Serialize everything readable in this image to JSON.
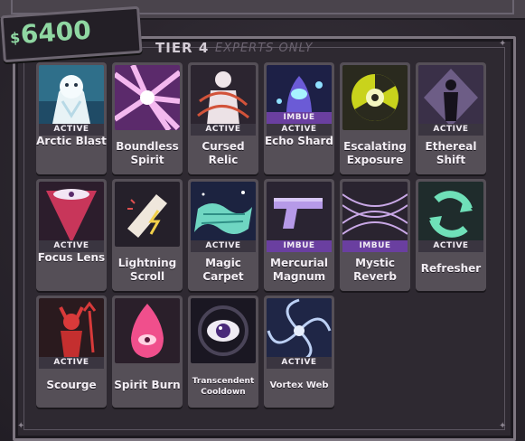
{
  "money": {
    "symbol": "$",
    "amount": "6400"
  },
  "tier": {
    "label": "TIER 4",
    "subtitle": "EXPERTS ONLY"
  },
  "cards": [
    {
      "name": "Arctic Blast",
      "active": "ACTIVE",
      "imbue": "",
      "icon": "polar-bear-icon"
    },
    {
      "name": "Boundless Spirit",
      "active": "",
      "imbue": "",
      "icon": "spirit-burst-icon"
    },
    {
      "name": "Cursed Relic",
      "active": "ACTIVE",
      "imbue": "",
      "icon": "cursed-figure-icon"
    },
    {
      "name": "Echo Shard",
      "active": "ACTIVE",
      "imbue": "IMBUE",
      "icon": "shard-creature-icon"
    },
    {
      "name": "Escalating Exposure",
      "active": "",
      "imbue": "",
      "icon": "radiation-eye-icon"
    },
    {
      "name": "Ethereal Shift",
      "active": "ACTIVE",
      "imbue": "",
      "icon": "ethereal-figure-icon"
    },
    {
      "name": "Focus Lens",
      "active": "ACTIVE",
      "imbue": "",
      "icon": "focus-lens-icon"
    },
    {
      "name": "Lightning Scroll",
      "active": "",
      "imbue": "",
      "icon": "scroll-icon"
    },
    {
      "name": "Magic Carpet",
      "active": "ACTIVE",
      "imbue": "",
      "icon": "carpet-icon"
    },
    {
      "name": "Mercurial Magnum",
      "active": "",
      "imbue": "IMBUE",
      "icon": "pistol-icon"
    },
    {
      "name": "Mystic Reverb",
      "active": "",
      "imbue": "IMBUE",
      "icon": "reverb-waves-icon"
    },
    {
      "name": "Refresher",
      "active": "ACTIVE",
      "imbue": "",
      "icon": "refresh-arrows-icon"
    },
    {
      "name": "Scourge",
      "active": "ACTIVE",
      "imbue": "",
      "icon": "devil-icon"
    },
    {
      "name": "Spirit Burn",
      "active": "",
      "imbue": "",
      "icon": "flame-eye-icon"
    },
    {
      "name": "Transcendent Cooldown",
      "active": "",
      "imbue": "",
      "icon": "cosmic-eye-icon"
    },
    {
      "name": "Vortex Web",
      "active": "ACTIVE",
      "imbue": "",
      "icon": "vortex-icon"
    }
  ]
}
